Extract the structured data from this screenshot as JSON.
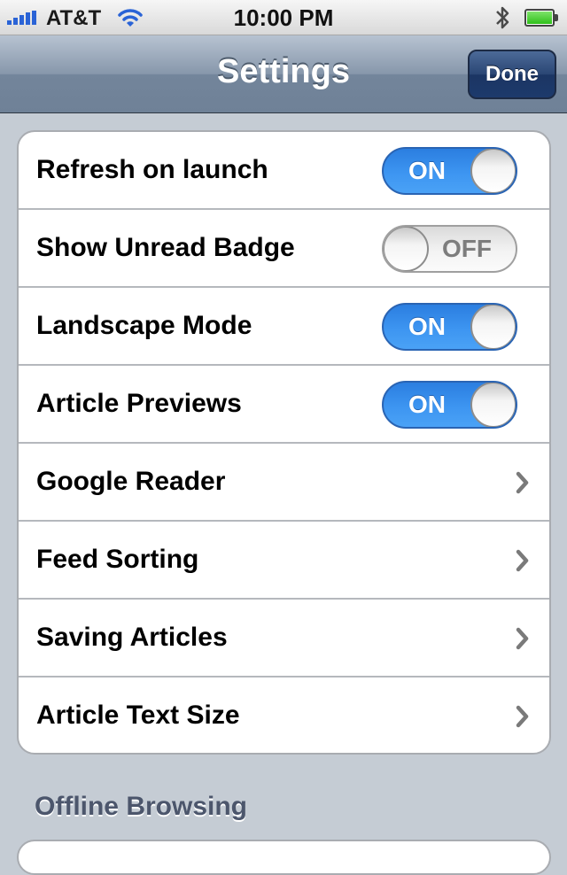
{
  "status_bar": {
    "carrier": "AT&T",
    "time": "10:00 PM",
    "icons": [
      "signal-icon",
      "wifi-icon",
      "bluetooth-icon",
      "battery-icon"
    ],
    "battery_level": 1.0
  },
  "nav": {
    "title": "Settings",
    "done_label": "Done"
  },
  "settings": {
    "rows": [
      {
        "label": "Refresh on launch",
        "type": "toggle",
        "state": "ON"
      },
      {
        "label": "Show Unread Badge",
        "type": "toggle",
        "state": "OFF"
      },
      {
        "label": "Landscape Mode",
        "type": "toggle",
        "state": "ON"
      },
      {
        "label": "Article Previews",
        "type": "toggle",
        "state": "ON"
      },
      {
        "label": "Google Reader",
        "type": "disclosure"
      },
      {
        "label": "Feed Sorting",
        "type": "disclosure"
      },
      {
        "label": "Saving Articles",
        "type": "disclosure"
      },
      {
        "label": "Article Text Size",
        "type": "disclosure"
      }
    ]
  },
  "offline": {
    "header": "Offline Browsing"
  },
  "colors": {
    "toggle_on": "#3d95f1",
    "nav_bar": "#8797ab",
    "done_button": "#2a4674",
    "background": "#c5ccd4"
  }
}
